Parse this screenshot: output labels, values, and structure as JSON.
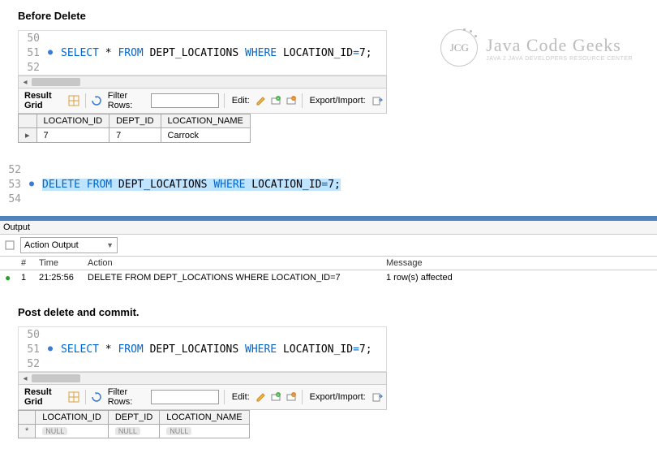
{
  "titles": {
    "before": "Before Delete",
    "post": "Post delete and commit."
  },
  "logo": {
    "initials": "JCG",
    "main": "Java Code Geeks",
    "sub": "JAVA 2 JAVA DEVELOPERS RESOURCE CENTER"
  },
  "editor1": {
    "lines": [
      {
        "num": "50",
        "dot": "",
        "code": []
      },
      {
        "num": "51",
        "dot": "●",
        "code": [
          {
            "t": "SELECT",
            "c": "kw"
          },
          {
            "t": " * ",
            "c": ""
          },
          {
            "t": "FROM",
            "c": "kw"
          },
          {
            "t": " DEPT_LOCATIONS ",
            "c": ""
          },
          {
            "t": "WHERE",
            "c": "kw"
          },
          {
            "t": " LOCATION_ID",
            "c": ""
          },
          {
            "t": "=",
            "c": "kw"
          },
          {
            "t": "7;",
            "c": ""
          }
        ]
      },
      {
        "num": "52",
        "dot": "",
        "code": []
      }
    ]
  },
  "toolbar": {
    "result_grid": "Result Grid",
    "filter_rows": "Filter Rows:",
    "edit": "Edit:",
    "export_import": "Export/Import:"
  },
  "table1": {
    "headers": [
      "LOCATION_ID",
      "DEPT_ID",
      "LOCATION_NAME"
    ],
    "rows": [
      [
        "7",
        "7",
        "Carrock"
      ]
    ]
  },
  "editor2": {
    "lines": [
      {
        "num": "52",
        "dot": "",
        "code": []
      },
      {
        "num": "53",
        "dot": "●",
        "code": [
          {
            "t": "DELETE",
            "c": "kw hl"
          },
          {
            "t": " ",
            "c": "hl"
          },
          {
            "t": "FROM",
            "c": "kw hl"
          },
          {
            "t": " DEPT_LOCATIONS ",
            "c": "hl"
          },
          {
            "t": "WHERE",
            "c": "kw hl"
          },
          {
            "t": " LOCATION_ID",
            "c": "hl"
          },
          {
            "t": "=",
            "c": "kw hl"
          },
          {
            "t": "7;",
            "c": "hl"
          }
        ]
      },
      {
        "num": "54",
        "dot": "",
        "code": []
      }
    ]
  },
  "output": {
    "title": "Output",
    "dropdown": "Action Output",
    "headers": {
      "num": "#",
      "time": "Time",
      "action": "Action",
      "message": "Message"
    },
    "rows": [
      {
        "ok": true,
        "num": "1",
        "time": "21:25:56",
        "action": "DELETE FROM DEPT_LOCATIONS WHERE LOCATION_ID=7",
        "message": "1 row(s) affected"
      }
    ]
  },
  "editor3": {
    "lines": [
      {
        "num": "50",
        "dot": "",
        "code": []
      },
      {
        "num": "51",
        "dot": "●",
        "code": [
          {
            "t": "SELECT",
            "c": "kw"
          },
          {
            "t": " * ",
            "c": ""
          },
          {
            "t": "FROM",
            "c": "kw"
          },
          {
            "t": " DEPT_LOCATIONS ",
            "c": ""
          },
          {
            "t": "WHERE",
            "c": "kw"
          },
          {
            "t": " LOCATION_ID",
            "c": ""
          },
          {
            "t": "=",
            "c": "kw"
          },
          {
            "t": "7;",
            "c": ""
          }
        ]
      },
      {
        "num": "52",
        "dot": "",
        "code": []
      }
    ]
  },
  "table2": {
    "headers": [
      "LOCATION_ID",
      "DEPT_ID",
      "LOCATION_NAME"
    ],
    "null": "NULL"
  }
}
